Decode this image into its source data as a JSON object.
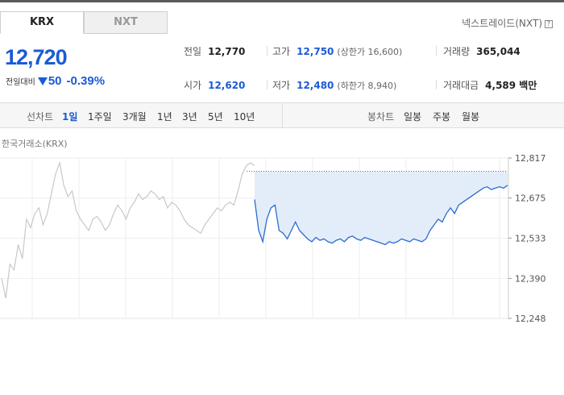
{
  "tabs": {
    "active": "KRX",
    "inactive": "NXT"
  },
  "nxt_link": {
    "label": "넥스트레이드(NXT)",
    "help_icon": "?"
  },
  "price": {
    "current": "12,720",
    "change_label": "전일대비",
    "change_value": "50",
    "change_pct": "-0.39%",
    "direction": "down",
    "color": "#1a5bd6"
  },
  "stats": {
    "prev_close": {
      "label": "전일",
      "value": "12,770"
    },
    "high": {
      "label": "고가",
      "value": "12,750",
      "sub": "(상한가 16,600)"
    },
    "volume": {
      "label": "거래량",
      "value": "365,044"
    },
    "open": {
      "label": "시가",
      "value": "12,620"
    },
    "low": {
      "label": "저가",
      "value": "12,480",
      "sub": "(하한가 8,940)"
    },
    "amount": {
      "label": "거래대금",
      "value": "4,589 백만"
    }
  },
  "period_bar": {
    "line_label": "선차트",
    "line_options": [
      "1일",
      "1주일",
      "3개월",
      "1년",
      "3년",
      "5년",
      "10년"
    ],
    "selected": "1일",
    "candle_label": "봉차트",
    "candle_options": [
      "일봉",
      "주봉",
      "월봉"
    ]
  },
  "chart_data": {
    "type": "line",
    "title": "한국거래소(KRX)",
    "y_ticks": [
      "12,817",
      "12,675",
      "12,533",
      "12,390",
      "12,248"
    ],
    "ylim": [
      12248,
      12817
    ],
    "prev_close": 12770,
    "series": [
      {
        "values": [
          12390,
          12320,
          12440,
          12420,
          12510,
          12460,
          12600,
          12570,
          12620,
          12640,
          12580,
          12620,
          12690,
          12760,
          12800,
          12720,
          12680,
          12700,
          12630,
          12600,
          12580,
          12560,
          12600,
          12610,
          12590,
          12560,
          12580,
          12620,
          12650,
          12630,
          12600,
          12640,
          12660,
          12690,
          12670,
          12680,
          12700,
          12690,
          12670,
          12680,
          12640,
          12660,
          12650,
          12630,
          12600,
          12580,
          12570,
          12560,
          12550,
          12580,
          12600,
          12620,
          12640,
          12630,
          12650,
          12660,
          12650,
          12700,
          12760,
          12790,
          12800,
          12790
        ]
      },
      {
        "values": [
          12670,
          12560,
          12520,
          12600,
          12640,
          12650,
          12560,
          12550,
          12530,
          12560,
          12590,
          12560,
          12545,
          12530,
          12520,
          12535,
          12525,
          12530,
          12520,
          12515,
          12525,
          12530,
          12520,
          12535,
          12540,
          12530,
          12525,
          12535,
          12530,
          12525,
          12520,
          12515,
          12510,
          12520,
          12515,
          12520,
          12530,
          12525,
          12520,
          12530,
          12525,
          12520,
          12530,
          12560,
          12580,
          12600,
          12590,
          12620,
          12640,
          12620,
          12650,
          12660,
          12670,
          12680,
          12690,
          12700,
          12710,
          12715,
          12705,
          12710,
          12715,
          12710,
          12720
        ]
      }
    ]
  }
}
